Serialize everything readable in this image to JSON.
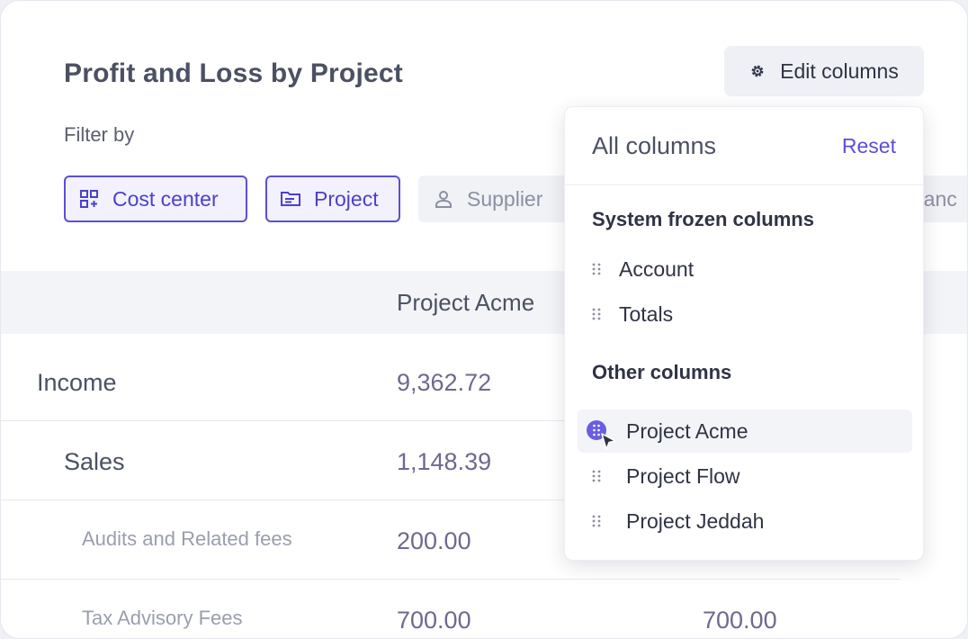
{
  "header": {
    "title": "Profit and Loss by Project",
    "edit_columns_label": "Edit columns"
  },
  "filters": {
    "label": "Filter by",
    "chips": [
      {
        "label": "Cost center",
        "icon": "cost-center-icon",
        "active": true
      },
      {
        "label": "Project",
        "icon": "folder-icon",
        "active": true
      },
      {
        "label": "Supplier",
        "icon": "user-icon",
        "active": false
      },
      {
        "label": "Branch",
        "icon": "branch-icon",
        "active": false,
        "visible_text": "ranc"
      }
    ]
  },
  "table": {
    "columns": [
      "Project Acme"
    ],
    "rows": [
      {
        "label": "Income",
        "values": [
          "9,362.72"
        ]
      },
      {
        "label": "Sales",
        "values": [
          "1,148.39"
        ]
      },
      {
        "label": "Audits and Related fees",
        "values": [
          "200.00"
        ]
      },
      {
        "label": "Tax Advisory Fees",
        "values": [
          "700.00",
          "700.00"
        ]
      }
    ]
  },
  "dropdown": {
    "title": "All columns",
    "reset_label": "Reset",
    "frozen_section": "System frozen columns",
    "frozen_items": [
      "Account",
      "Totals"
    ],
    "other_section": "Other columns",
    "other_items": [
      "Project Acme",
      "Project Flow",
      "Project Jeddah"
    ]
  },
  "colors": {
    "accent": "#5b4fd6",
    "text": "#4b5162",
    "value_text": "#6d6a8e",
    "muted": "#8b8fa0"
  }
}
